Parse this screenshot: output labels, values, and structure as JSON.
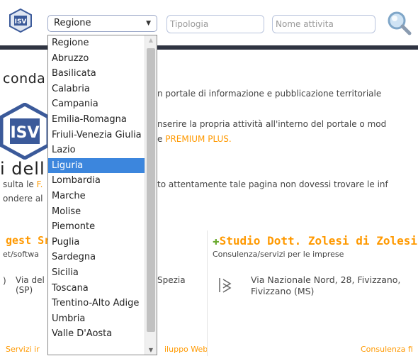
{
  "header": {
    "region_select_value": "Regione",
    "tipologia_placeholder": "Tipologia",
    "nome_attivita_placeholder": "Nome attivita"
  },
  "dropdown": {
    "options": [
      "Regione",
      "Abruzzo",
      "Basilicata",
      "Calabria",
      "Campania",
      "Emilia-Romagna",
      "Friuli-Venezia Giulia",
      "Lazio",
      "Liguria",
      "Lombardia",
      "Marche",
      "Molise",
      "Piemonte",
      "Puglia",
      "Sardegna",
      "Sicilia",
      "Toscana",
      "Trentino-Alto Adige",
      "Umbria",
      "Valle D'Aosta"
    ],
    "highlighted": "Liguria"
  },
  "background": {
    "hero_title_fragment": "conda",
    "hero_title2_fragment": "i dell",
    "line1": "n portale di informazione e pubblicazione territoriale",
    "line2": "nserire la propria attività all'interno del portale o mod",
    "line3_prefix": "e ",
    "line3_link": "PREMIUM PLUS.",
    "line4_left_prefix": "sulta le ",
    "line4_left_link": "F.",
    "line4_right": "to attentamente tale pagina non dovessi trovare le inf",
    "line5_left_prefix": "ondere al",
    "left_card_title": "gest Sr",
    "left_card_category": "et/softwa",
    "left_card_address1": "Via del",
    "left_card_address2": "(SP)",
    "left_card_city": "Spezia",
    "left_footer_left": "Servizi ir",
    "left_footer_right": "iluppo Web",
    "right_card_title": "Studio Dott. Zolesi di Zolesi Em",
    "right_card_category": "Consulenza/servizi per le imprese",
    "right_card_address1": "Via Nazionale Nord, 28, Fivizzano,",
    "right_card_address2": "Fivizzano (MS)",
    "right_footer": "Consulenza fi"
  },
  "colors": {
    "accent": "#ff9900",
    "selection": "#3c86dd",
    "plus": "#6aaa2e"
  }
}
